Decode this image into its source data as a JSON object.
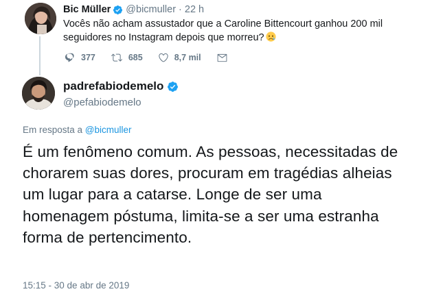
{
  "original_tweet": {
    "author_name": "Bic Müller",
    "author_handle": "@bicmuller",
    "separator": "·",
    "time": "22 h",
    "text": "Vocês não acham assustador que a Caroline Bittencourt ganhou 200 mil seguidores no Instagram depois que morreu?",
    "emoji": "sad-face-emoji",
    "replies": "377",
    "retweets": "685",
    "likes": "8,7 mil"
  },
  "reply_tweet": {
    "author_name": "padrefabiodemelo",
    "author_handle": "@pefabiodemelo",
    "in_reply_prefix": "Em resposta a ",
    "in_reply_mention": "@bicmuller",
    "text": "É um fenômeno comum. As pessoas, necessitadas de chorarem suas dores, procuram em tragédias alheias um lugar para a catarse. Longe de ser uma homenagem póstuma, limita-se a ser uma estranha forma de pertencimento.",
    "timestamp": "15:15 - 30 de abr de 2019"
  },
  "colors": {
    "text": "#14171a",
    "secondary": "#657786",
    "link": "#1b95e0",
    "verified": "#1da1f2",
    "thread_line": "#ccd6dd"
  },
  "icons": [
    "verified-badge-icon",
    "reply-icon",
    "retweet-icon",
    "like-icon",
    "message-icon"
  ]
}
